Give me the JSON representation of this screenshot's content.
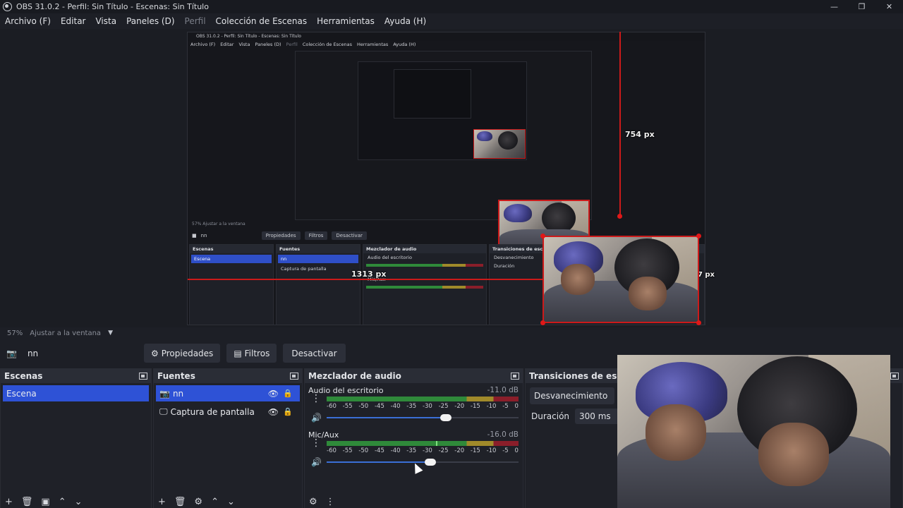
{
  "window": {
    "title": "OBS 31.0.2 - Perfil: Sin Título - Escenas: Sin Título",
    "controls": [
      "—",
      "❐",
      "✕"
    ]
  },
  "menu": [
    {
      "label": "Archivo (F)",
      "disabled": false
    },
    {
      "label": "Editar",
      "disabled": false
    },
    {
      "label": "Vista",
      "disabled": false
    },
    {
      "label": "Paneles (D)",
      "disabled": false
    },
    {
      "label": "Perfil",
      "disabled": true
    },
    {
      "label": "Colección de Escenas",
      "disabled": false
    },
    {
      "label": "Herramientas",
      "disabled": false
    },
    {
      "label": "Ayuda (H)",
      "disabled": false
    }
  ],
  "preview": {
    "overlay_height": "754 px",
    "overlay_width": "1313 px",
    "overlay_offset": "27 px",
    "nested_title": "OBS 31.0.2 - Perfil: Sin Título - Escenas: Sin Título",
    "nested_status": "57%   Ajustar a la ventana",
    "nested_source": "nn"
  },
  "status": {
    "zoom": "57%",
    "fit_label": "Ajustar a la ventana"
  },
  "source_toolbar": {
    "source_name": "nn",
    "properties": "Propiedades",
    "filters": "Filtros",
    "deactivate": "Desactivar"
  },
  "scenes": {
    "title": "Escenas",
    "items": [
      "Escena"
    ]
  },
  "sources": {
    "title": "Fuentes",
    "items": [
      {
        "label": "nn",
        "icon": "camera-icon"
      },
      {
        "label": "Captura de pantalla",
        "icon": "monitor-icon"
      }
    ]
  },
  "mixer": {
    "title": "Mezclador de audio",
    "ticks": [
      "-60",
      "-55",
      "-50",
      "-45",
      "-40",
      "-35",
      "-30",
      "-25",
      "-20",
      "-15",
      "-10",
      "-5",
      "0"
    ],
    "channels": [
      {
        "name": "Audio del escritorio",
        "db": "-11.0 dB",
        "volume": 0.62,
        "level": null
      },
      {
        "name": "Mic/Aux",
        "db": "-16.0 dB",
        "volume": 0.54,
        "level": 0.57
      }
    ]
  },
  "transitions": {
    "title": "Transiciones de escena",
    "selected": "Desvanecimiento",
    "duration_label": "Duración",
    "duration_value": "300 ms"
  },
  "colors": {
    "accent": "#2e52d6",
    "selection_outline": "#cc1a1a",
    "meter_green": "#2f8a3a",
    "meter_yellow": "#a08a2a",
    "meter_red": "#8a1e2a"
  }
}
